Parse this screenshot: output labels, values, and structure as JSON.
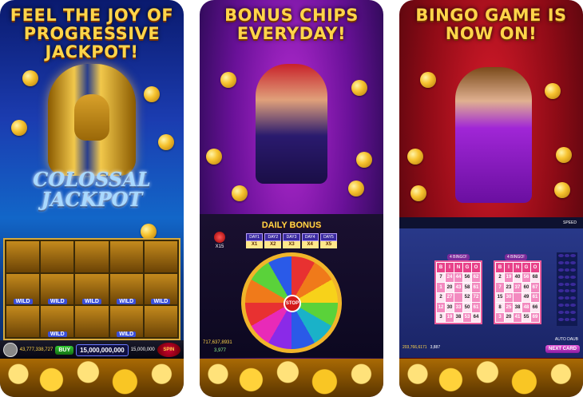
{
  "cards": [
    {
      "headline": [
        "FEEL THE JOY OF",
        "PROGRESSIVE JACKPOT!"
      ],
      "logo": [
        "COLOSSAL",
        "JACKPOT"
      ],
      "reels": [
        "",
        "",
        "",
        "",
        "",
        "WILD",
        "WILD",
        "WILD",
        "WILD",
        "WILD",
        "",
        "WILD",
        "",
        "WILD",
        ""
      ],
      "hud": {
        "coins": "43,777,338,727",
        "buy_label": "BUY",
        "total": "15,000,000,000",
        "bet": "15,000,000",
        "spin_label": "SPIN"
      }
    },
    {
      "headline": [
        "BONUS CHIPS",
        "EVERYDAY!"
      ],
      "daily_bonus": {
        "title": "DAILY BONUS",
        "days": [
          "DAY1",
          "DAY2",
          "DAY3",
          "DAY4",
          "DAY5"
        ],
        "multipliers": [
          "X1",
          "X2",
          "X3",
          "X4",
          "X5"
        ],
        "stop_label": "STOP",
        "side_bonus": "X15"
      },
      "hud": {
        "coins": "717,637,8931",
        "level": "3,977"
      }
    },
    {
      "headline": [
        "BINGO GAME IS",
        "NOW ON!"
      ],
      "hud": {
        "speed_label": "SPEED"
      },
      "bingo_cards": [
        {
          "label": "4 BINGO!",
          "header": [
            "B",
            "I",
            "N",
            "G",
            "O"
          ],
          "numbers": [
            "7",
            "24",
            "44",
            "56",
            "62",
            "1",
            "20",
            "43",
            "58",
            "61",
            "2",
            "27",
            "",
            "52",
            "72",
            "12",
            "30",
            "33",
            "50",
            "61",
            "3",
            "19",
            "38",
            "53",
            "64"
          ]
        },
        {
          "label": "4 BINGO!",
          "header": [
            "B",
            "I",
            "N",
            "G",
            "O"
          ],
          "numbers": [
            "2",
            "19",
            "40",
            "56",
            "68",
            "7",
            "23",
            "37",
            "60",
            "67",
            "15",
            "30",
            "",
            "49",
            "61",
            "8",
            "25",
            "38",
            "48",
            "66",
            "3",
            "20",
            "41",
            "55",
            "69"
          ]
        }
      ],
      "auto_daub": "AUTO DAUB",
      "next_card": "NEXT CARD",
      "stats": {
        "coins": "203,766,6171",
        "level": "3,887"
      }
    }
  ]
}
